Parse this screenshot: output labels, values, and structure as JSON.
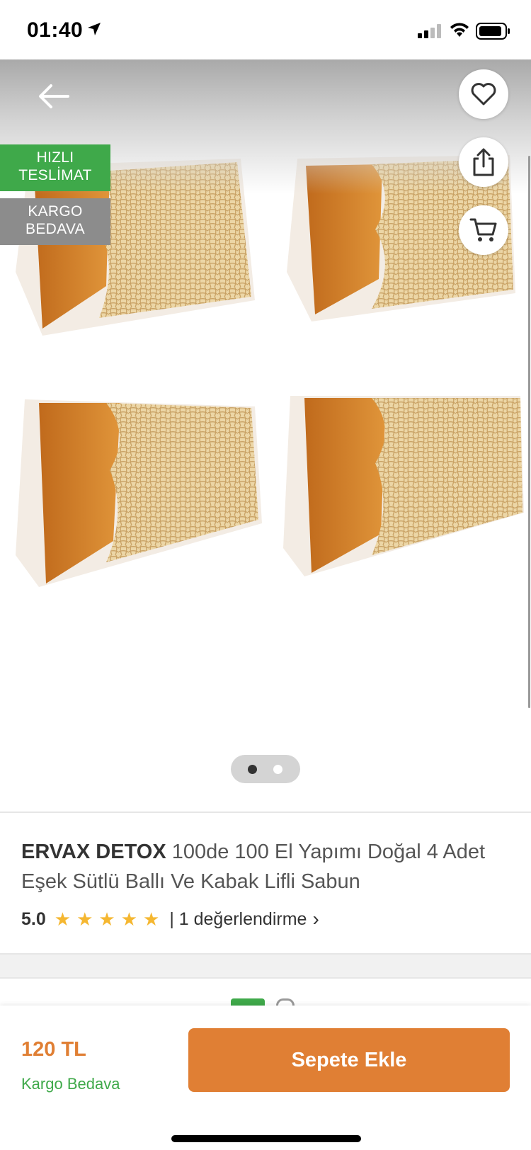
{
  "status_bar": {
    "time": "01:40"
  },
  "gallery": {
    "badges": [
      "HIZLI\nTESLİMAT",
      "KARGO\nBEDAVA"
    ],
    "icons": {
      "back": "arrow-left-icon",
      "favorite": "heart-icon",
      "share": "share-icon",
      "cart": "cart-icon"
    },
    "page_count": 2,
    "active_page": 1
  },
  "product": {
    "brand": "ERVAX DETOX",
    "name": "100de 100 El Yapımı Doğal 4 Adet Eşek Sütlü Ballı Ve Kabak Lifli Sabun",
    "rating": "5.0",
    "stars": 5,
    "reviews_label": "| 1 değerlendirme",
    "reviews_chevron": "›"
  },
  "bottom_bar": {
    "price": "120 TL",
    "shipping": "Kargo Bedava",
    "add_to_cart": "Sepete Ekle"
  },
  "colors": {
    "accent": "#e07f34",
    "green": "#3fa94a",
    "star": "#f5b731"
  }
}
